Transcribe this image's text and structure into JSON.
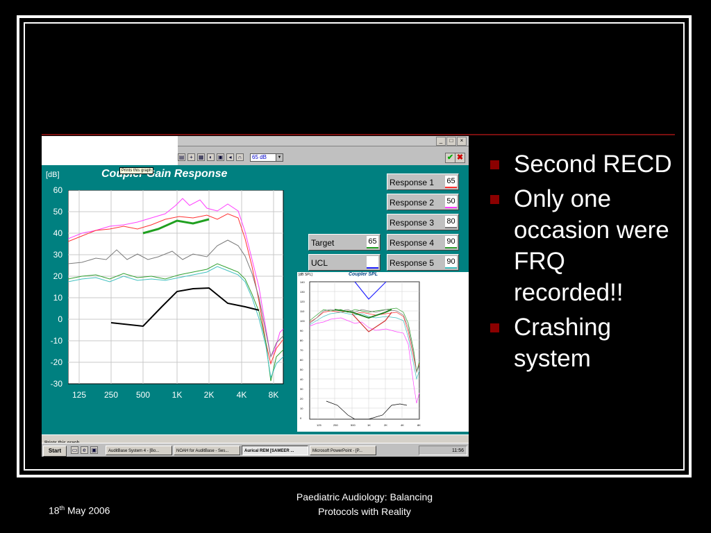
{
  "slide": {
    "bullets": [
      "Second RECD",
      "Only one occasion were FRQ recorded!!",
      "Crashing system"
    ],
    "footer": {
      "date_day": "18",
      "date_suffix": "th",
      "date_rest": " May 2006",
      "title_line1": "Paediatric Audiology: Balancing",
      "title_line2": "Protocols with Reality"
    },
    "colors": {
      "background": "#000000",
      "bullet": "#8b0000",
      "rule": "#7a0f0f"
    }
  },
  "screenshot": {
    "window_controls": [
      "_",
      "□",
      "×"
    ],
    "toolbar": {
      "level_select": "65 dB",
      "tooltip": "Prints this graph"
    },
    "main_chart": {
      "title": "Coupler Gain Response",
      "unit": "[dB]",
      "y_ticks": [
        "60",
        "50",
        "40",
        "30",
        "20",
        "10",
        "0",
        "-10",
        "-20",
        "-30"
      ],
      "x_ticks": [
        "125",
        "250",
        "500",
        "1K",
        "2K",
        "4K",
        "8K"
      ]
    },
    "target": {
      "label": "Target",
      "value": "65"
    },
    "ucl": {
      "label": "UCL",
      "value": ""
    },
    "responses": [
      {
        "label": "Response 1",
        "value": "65",
        "color": "#ff3030"
      },
      {
        "label": "Response 2",
        "value": "50",
        "color": "#ff40ff"
      },
      {
        "label": "Response 3",
        "value": "80",
        "color": "#7a7a7a"
      },
      {
        "label": "Response 4",
        "value": "90",
        "color": "#30a030"
      },
      {
        "label": "Response 5",
        "value": "90",
        "color": "#40c0c0"
      }
    ],
    "spl_chart": {
      "title": "Coupler SPL",
      "unit": "[dB SPL]",
      "y_ticks": [
        "140",
        "130",
        "120",
        "110",
        "100",
        "90",
        "80",
        "70",
        "60",
        "50",
        "40",
        "30",
        "20",
        "10",
        "0"
      ],
      "x_ticks": [
        "125",
        "250",
        "500",
        "1K",
        "2K",
        "4K",
        "8K"
      ]
    },
    "status_text": "Prints this graph",
    "taskbar": {
      "start": "Start",
      "tasks": [
        "AuditBase System 4 - [Bo...",
        "NOAH for AuditBase - Ses...",
        "Aurical REM [SAMEER ...",
        "Microsoft PowerPoint - [P..."
      ],
      "clock": "11:56"
    }
  }
}
